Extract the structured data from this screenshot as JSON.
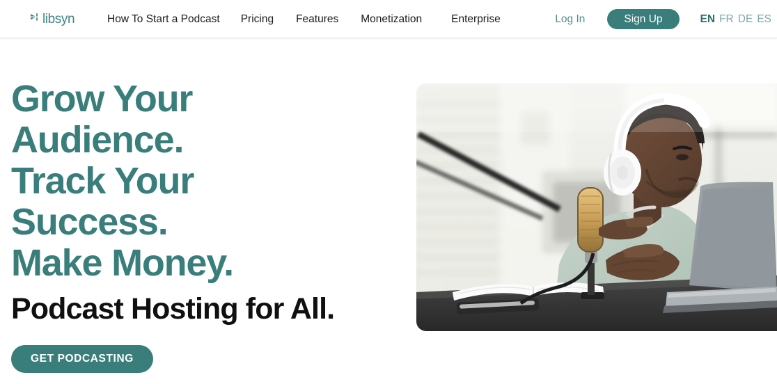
{
  "header": {
    "logo": {
      "text": "libsyn",
      "icon": "libsyn-logo-mark",
      "color": "#3d8583"
    },
    "nav_items": [
      {
        "label": "How To Start a Podcast"
      },
      {
        "label": "Pricing"
      },
      {
        "label": "Features"
      },
      {
        "label": "Monetization"
      },
      {
        "label": "Enterprise"
      }
    ],
    "login_label": "Log In",
    "signup_label": "Sign Up",
    "languages": [
      {
        "code": "EN",
        "active": true
      },
      {
        "code": "FR",
        "active": false
      },
      {
        "code": "DE",
        "active": false
      },
      {
        "code": "ES",
        "active": false
      }
    ]
  },
  "hero": {
    "headline_lines": [
      "Grow Your",
      "Audience.",
      "Track Your",
      "Success.",
      "Make Money."
    ],
    "subheadline": "Podcast Hosting for All.",
    "cta_label": "GET PODCASTING",
    "image_alt": "Man wearing white over-ear headphones speaking into a studio microphone at a desk with an open notebook and laptop",
    "colors": {
      "teal": "#3a7e7c",
      "headline_teal": "#3a7e7c",
      "subheadline_black": "#101010",
      "login_teal": "#50908e",
      "lang_muted": "#7fa9a7"
    }
  }
}
